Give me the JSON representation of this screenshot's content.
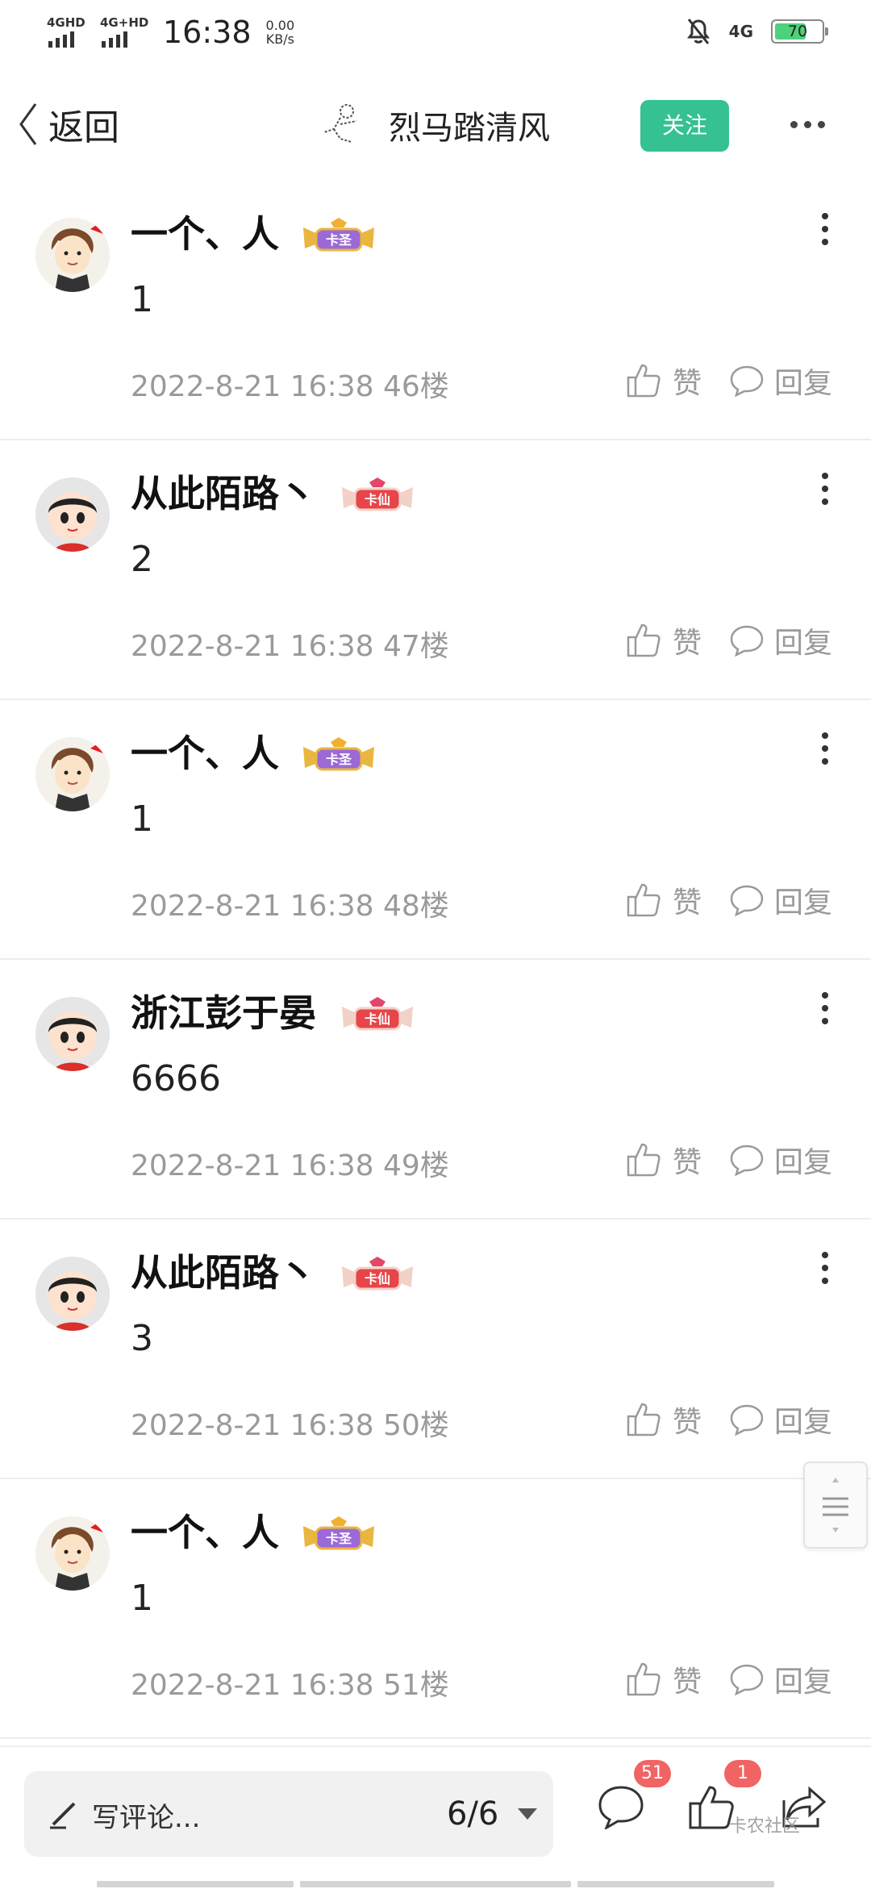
{
  "status_bar": {
    "net1": "4GHD",
    "net2": "4G+HD",
    "time": "16:38",
    "speed_value": "0.00",
    "speed_unit": "KB/s",
    "net_right": "4G",
    "battery": "70",
    "battery_level": 0.7
  },
  "header": {
    "back_label": "返回",
    "author": "烈马踏清风",
    "follow_label": "关注"
  },
  "comments": [
    {
      "name": "一个、人",
      "badge": "卡圣",
      "text": "1",
      "date": "2022-8-21 16:38",
      "floor": "46楼",
      "like": "赞",
      "reply": "回复"
    },
    {
      "name": "从此陌路丶",
      "badge": "卡仙",
      "text": "2",
      "date": "2022-8-21 16:38",
      "floor": "47楼",
      "like": "赞",
      "reply": "回复"
    },
    {
      "name": "一个、人",
      "badge": "卡圣",
      "text": "1",
      "date": "2022-8-21 16:38",
      "floor": "48楼",
      "like": "赞",
      "reply": "回复"
    },
    {
      "name": "浙江彭于晏",
      "badge": "卡仙",
      "text": "6666",
      "date": "2022-8-21 16:38",
      "floor": "49楼",
      "like": "赞",
      "reply": "回复"
    },
    {
      "name": "从此陌路丶",
      "badge": "卡仙",
      "text": "3",
      "date": "2022-8-21 16:38",
      "floor": "50楼",
      "like": "赞",
      "reply": "回复"
    },
    {
      "name": "一个、人",
      "badge": "卡圣",
      "text": "1",
      "date": "2022-8-21 16:38",
      "floor": "51楼",
      "like": "赞",
      "reply": "回复"
    }
  ],
  "bottom_bar": {
    "compose_placeholder": "写评论...",
    "page_indicator": "6/6",
    "comment_count": "51",
    "like_count": "1",
    "watermark": "卡农社区"
  },
  "colors": {
    "accent": "#35c192",
    "badge_red": "#f16464",
    "meta_gray": "#9a9a9a"
  }
}
